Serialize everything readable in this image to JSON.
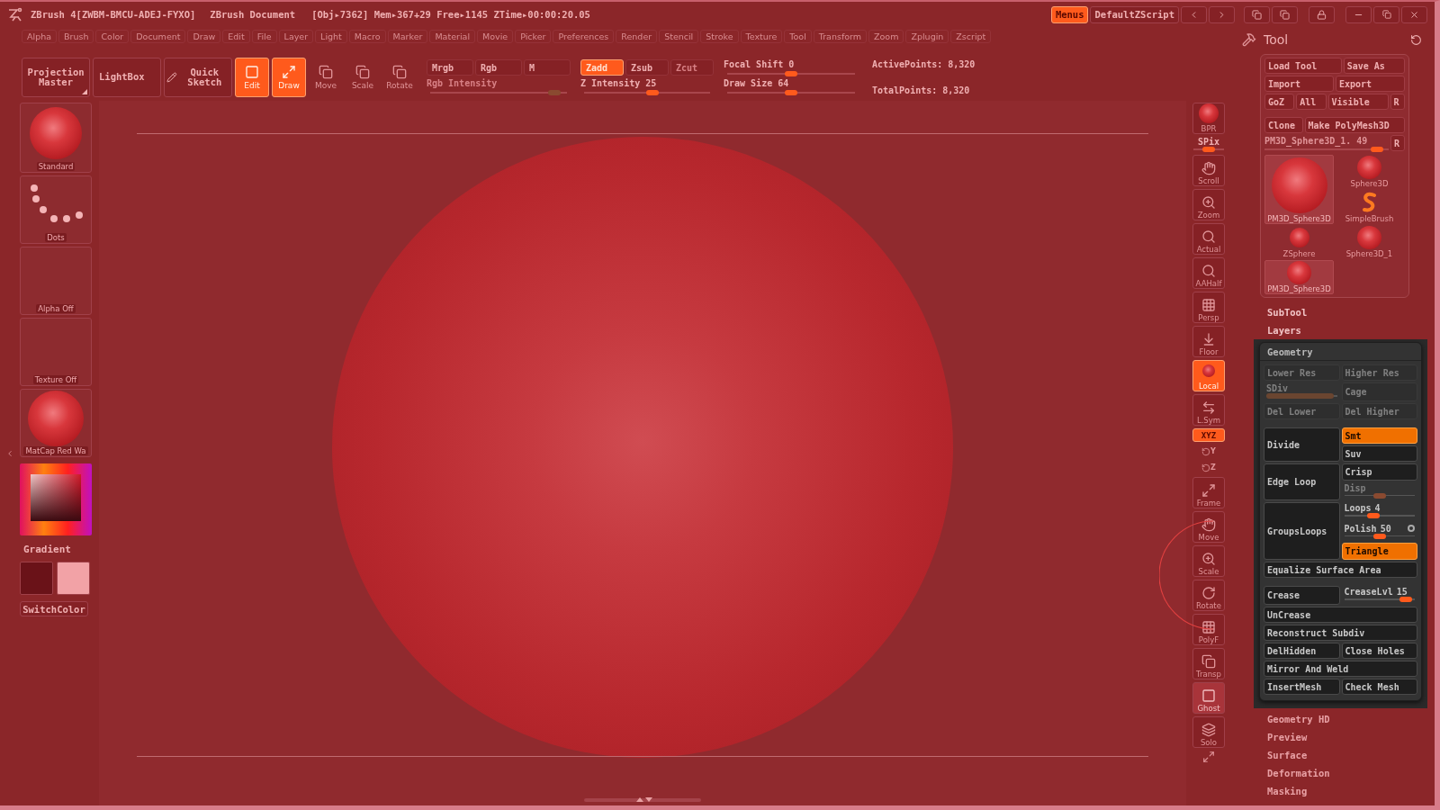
{
  "title_bar": {
    "app": "ZBrush 4[ZWBM-BMCU-ADEJ-FYXO]",
    "document": "ZBrush Document",
    "stats": "[Obj▸7362] Mem▸367+29 Free▸1145 ZTime▸00:00:20.05"
  },
  "top_buttons": [
    {
      "label": "Menus",
      "selected": true
    },
    {
      "label": "DefaultZScript",
      "selected": false
    }
  ],
  "menu_bar": [
    "Alpha",
    "Brush",
    "Color",
    "Document",
    "Draw",
    "Edit",
    "File",
    "Layer",
    "Light",
    "Macro",
    "Marker",
    "Material",
    "Movie",
    "Picker",
    "Preferences",
    "Render",
    "Stencil",
    "Stroke",
    "Texture",
    "Tool",
    "Transform",
    "Zoom",
    "Zplugin",
    "Zscript"
  ],
  "toolbar": {
    "big_buttons": [
      {
        "label": "Projection Master",
        "kind": "corner"
      },
      {
        "label": "LightBox",
        "kind": "text"
      },
      {
        "label": "Quick Sketch",
        "kind": "icon"
      }
    ],
    "modes": [
      {
        "label": "Edit",
        "selected": true
      },
      {
        "label": "Draw",
        "selected": true
      },
      {
        "label": "Move",
        "selected": false
      },
      {
        "label": "Scale",
        "selected": false
      },
      {
        "label": "Rotate",
        "selected": false
      }
    ],
    "color_modes": [
      {
        "label": "Mrgb",
        "selected": false
      },
      {
        "label": "Rgb",
        "selected": false
      },
      {
        "label": "M",
        "selected": false
      }
    ],
    "rgb_intensity": {
      "label": "Rgb Intensity",
      "level": 0.95,
      "disabled": true
    },
    "depth_modes": [
      {
        "label": "Zadd",
        "selected": true,
        "disabled": false
      },
      {
        "label": "Zsub",
        "selected": false,
        "disabled": false
      },
      {
        "label": "Zcut",
        "selected": false,
        "disabled": true
      }
    ],
    "z_intensity": {
      "label": "Z Intensity",
      "value": "25",
      "level": 0.55,
      "disabled": false
    },
    "focal_shift": {
      "label": "Focal Shift",
      "value": "0",
      "level": 0.5,
      "disabled": false
    },
    "draw_size": {
      "label": "Draw Size",
      "value": "64",
      "level": 0.5,
      "disabled": false
    },
    "stats": [
      "ActivePoints: 8,320",
      "TotalPoints: 8,320"
    ]
  },
  "left_panel": {
    "brush": "Standard",
    "stroke": "Dots",
    "alpha": "Alpha Off",
    "texture": "Texture Off",
    "material": "MatCap Red Wa",
    "gradient": "Gradient",
    "swatches": [
      {
        "color": "#6a1218"
      },
      {
        "color": "#f2a2a6"
      }
    ],
    "switch_color": "SwitchColor"
  },
  "shelf": [
    {
      "label": "BPR",
      "kind": "button",
      "selected": false,
      "disabled": false
    },
    {
      "label": "SPix",
      "kind": "slider",
      "level": 0.5
    },
    {
      "label": "Scroll",
      "kind": "button",
      "selected": false,
      "disabled": false
    },
    {
      "label": "Zoom",
      "kind": "button",
      "selected": false,
      "disabled": false
    },
    {
      "label": "Actual",
      "kind": "button",
      "selected": false,
      "disabled": false
    },
    {
      "label": "AAHalf",
      "kind": "button",
      "selected": false,
      "disabled": false
    },
    {
      "label": "Persp",
      "kind": "button",
      "selected": false,
      "disabled": false
    },
    {
      "label": "Floor",
      "kind": "button",
      "selected": false,
      "disabled": false
    },
    {
      "label": "Local",
      "kind": "button",
      "selected": true,
      "disabled": false
    },
    {
      "label": "L.Sym",
      "kind": "button",
      "selected": false,
      "disabled": false
    },
    {
      "label": "XYZ",
      "kind": "toggle",
      "selected": true
    },
    {
      "label": "Y",
      "kind": "axis"
    },
    {
      "label": "Z",
      "kind": "axis"
    },
    {
      "label": "Frame",
      "kind": "button",
      "selected": false,
      "disabled": false
    },
    {
      "label": "Move",
      "kind": "button",
      "selected": false,
      "disabled": false
    },
    {
      "label": "Scale",
      "kind": "button",
      "selected": false,
      "disabled": false
    },
    {
      "label": "Rotate",
      "kind": "button",
      "selected": false,
      "disabled": false
    },
    {
      "label": "PolyF",
      "kind": "button",
      "selected": false,
      "disabled": false
    },
    {
      "label": "Transp",
      "kind": "button",
      "selected": false,
      "disabled": false
    },
    {
      "label": "Ghost",
      "kind": "button",
      "selected": false,
      "disabled": true
    },
    {
      "label": "Solo",
      "kind": "button",
      "selected": false,
      "disabled": false
    },
    {
      "kind": "icon"
    }
  ],
  "tool_panel": {
    "title": "Tool",
    "button_rows": [
      [
        "Load Tool",
        "Save As"
      ],
      [
        "Import",
        "Export"
      ],
      [
        "GoZ",
        "All",
        "Visible",
        "R"
      ],
      [
        "Clone",
        "Make PolyMesh3D"
      ]
    ],
    "tool_slider": {
      "label": "PM3D_Sphere3D_1. 49",
      "level": 0.95,
      "button": "R"
    },
    "current_tool": {
      "label": "PM3D_Sphere3D",
      "kind": "large",
      "selected": true
    },
    "tools": [
      {
        "label": "Sphere3D",
        "kind": "sphere",
        "selected": false
      },
      {
        "label": "SimpleBrush",
        "kind": "brush",
        "selected": false
      },
      {
        "label": "ZSphere",
        "kind": "zsphere",
        "selected": false
      },
      {
        "label": "Sphere3D_1",
        "kind": "sphere",
        "selected": false
      },
      {
        "label": "PM3D_Sphere3D",
        "kind": "sphere",
        "selected": true
      }
    ],
    "sections": [
      {
        "label": "SubTool",
        "expanded": false
      },
      {
        "label": "Layers",
        "expanded": false
      },
      {
        "label": "Geometry",
        "expanded": true
      },
      {
        "label": "Geometry HD",
        "expanded": false
      },
      {
        "label": "Preview",
        "expanded": false
      },
      {
        "label": "Surface",
        "expanded": false
      },
      {
        "label": "Deformation",
        "expanded": false
      },
      {
        "label": "Masking",
        "expanded": false
      }
    ],
    "geometry": [
      [
        {
          "main": {
            "kind": "button",
            "label": "Lower Res",
            "disabled": true,
            "selected": false
          },
          "side": [
            {
              "kind": "button",
              "label": "Higher Res",
              "disabled": true,
              "selected": false
            }
          ]
        },
        {
          "main": {
            "kind": "bar",
            "label": "SDiv",
            "disabled": true,
            "level": 0.95
          },
          "side": [
            {
              "kind": "button",
              "label": "Cage",
              "disabled": true,
              "selected": false
            }
          ]
        },
        {
          "main": {
            "kind": "button",
            "label": "Del Lower",
            "disabled": true,
            "selected": false
          },
          "side": [
            {
              "kind": "button",
              "label": "Del Higher",
              "disabled": true,
              "selected": false
            }
          ]
        }
      ],
      [
        {
          "main": {
            "kind": "button",
            "label": "Divide",
            "disabled": false,
            "selected": false
          },
          "side": [
            {
              "kind": "button",
              "label": "Smt",
              "disabled": false,
              "selected": true
            },
            {
              "kind": "button",
              "label": "Suv",
              "disabled": false,
              "selected": false
            }
          ]
        },
        {
          "main": {
            "kind": "button",
            "label": "Edge Loop",
            "disabled": false,
            "selected": false
          },
          "side": [
            {
              "kind": "button",
              "label": "Crisp",
              "disabled": false,
              "selected": false
            },
            {
              "kind": "slider",
              "label": "Disp",
              "disabled": true,
              "level": 0.5
            }
          ]
        },
        {
          "main": {
            "kind": "button",
            "label": "GroupsLoops",
            "disabled": false,
            "selected": false
          },
          "side": [
            {
              "kind": "slider",
              "label": "Loops",
              "value": "4",
              "disabled": false,
              "level": 0.4
            },
            {
              "kind": "toggle_slider",
              "label": "Polish",
              "value": "50",
              "disabled": false,
              "level": 0.5
            },
            {
              "kind": "button",
              "label": "Triangle",
              "disabled": false,
              "selected": true
            }
          ]
        },
        {
          "main": {
            "kind": "button",
            "label": "Equalize Surface Area",
            "disabled": false,
            "selected": false
          }
        }
      ],
      [
        {
          "main": {
            "kind": "button",
            "label": "Crease",
            "disabled": false,
            "selected": false
          },
          "side": [
            {
              "kind": "slider",
              "label": "CreaseLvl",
              "value": "15",
              "disabled": false,
              "level": 0.95
            }
          ]
        },
        {
          "main": {
            "kind": "button",
            "label": "UnCrease",
            "disabled": false,
            "selected": false
          }
        },
        {
          "main": {
            "kind": "button",
            "label": "Reconstruct Subdiv",
            "disabled": false,
            "selected": false
          }
        },
        {
          "main": {
            "kind": "button",
            "label": "DelHidden",
            "disabled": false,
            "selected": false
          },
          "side": [
            {
              "kind": "button",
              "label": "Close Holes",
              "disabled": false,
              "selected": false
            }
          ]
        },
        {
          "main": {
            "kind": "button",
            "label": "Mirror And Weld",
            "disabled": false,
            "selected": false
          }
        },
        {
          "main": {
            "kind": "button",
            "label": "InsertMesh",
            "disabled": false,
            "selected": false
          },
          "side": [
            {
              "kind": "button",
              "label": "Check Mesh",
              "disabled": false,
              "selected": false
            }
          ]
        }
      ]
    ]
  }
}
